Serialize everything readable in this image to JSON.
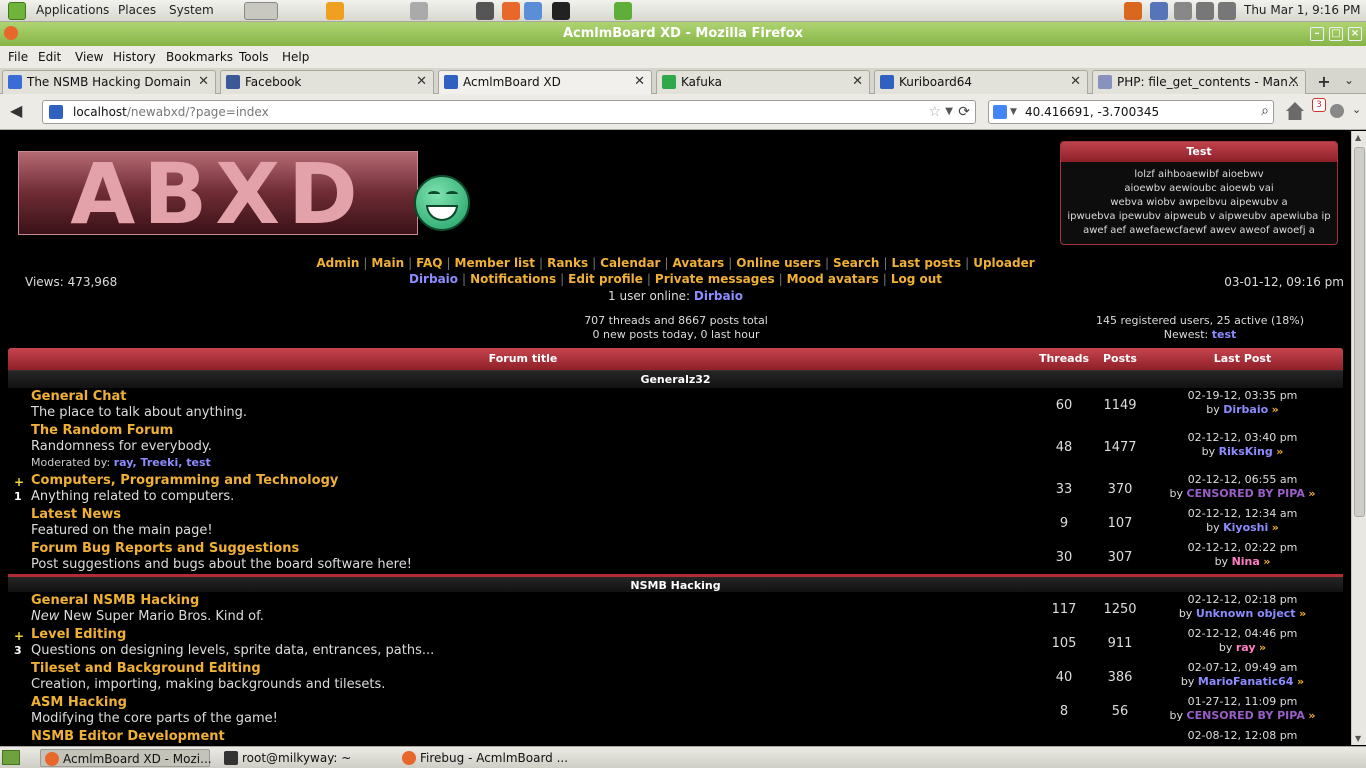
{
  "system": {
    "menus": [
      "Applications",
      "Places",
      "System"
    ],
    "clock": "Thu Mar  1,  9:16 PM"
  },
  "window": {
    "title": "AcmlmBoard XD - Mozilla Firefox"
  },
  "menubar": [
    "File",
    "Edit",
    "View",
    "History",
    "Bookmarks",
    "Tools",
    "Help"
  ],
  "tabs": [
    {
      "label": "The NSMB Hacking Domain",
      "color": "#3b6bd6"
    },
    {
      "label": "Facebook",
      "color": "#3b5998"
    },
    {
      "label": "AcmlmBoard XD",
      "color": "#3060c0"
    },
    {
      "label": "Kafuka",
      "color": "#2da84a"
    },
    {
      "label": "Kuriboard64",
      "color": "#3060c0"
    },
    {
      "label": "PHP: file_get_contents - Man...",
      "color": "#8892bf"
    }
  ],
  "nav": {
    "url_host": "localhost",
    "url_path": "/newabxd/?page=index",
    "search_value": "40.416691, -3.700345",
    "badge": "3"
  },
  "site": {
    "logo_text": "ABXD",
    "test_box": {
      "title": "Test",
      "lines": [
        "lolzf aihboaewibf aioebwv",
        "aioewbv aewioubc aioewb vai",
        "webva wiobv awpeibvu aipewubv a",
        "ipwuebva ipewubv aipweub v aipweubv apewiuba ip",
        "awef aef awefaewcfaewf awev aweof awoefj a"
      ]
    },
    "links_row1": [
      "Admin",
      "Main",
      "FAQ",
      "Member list",
      "Ranks",
      "Calendar",
      "Avatars",
      "Online users",
      "Search",
      "Last posts",
      "Uploader"
    ],
    "links_row2": [
      "Dirbaio",
      "Notifications",
      "Edit profile",
      "Private messages",
      "Mood avatars",
      "Log out"
    ],
    "online_prefix": "1 user online: ",
    "online_user": "Dirbaio",
    "views": "Views: 473,968",
    "datetime": "03-01-12, 09:16 pm",
    "stats_line1": "707 threads and 8667 posts total",
    "stats_line2": "0 new posts today, 0 last hour",
    "users_line1": "145 registered users, 25 active (18%)",
    "newest_label": "Newest: ",
    "newest_user": "test"
  },
  "forum_table": {
    "headers": {
      "title": "Forum title",
      "threads": "Threads",
      "posts": "Posts",
      "last": "Last Post"
    },
    "categories": [
      {
        "name": "Generalz32",
        "forums": [
          {
            "title": "General Chat",
            "desc": "The place to talk about anything.",
            "threads": "60",
            "posts": "1149",
            "date": "02-19-12, 03:35 pm",
            "by": "Dirbaio",
            "by_color": "#8c8cff"
          },
          {
            "title": "The Random Forum",
            "desc": "Randomness for everybody.",
            "mod_label": "Moderated by: ",
            "mods": "ray, Treeki, test",
            "threads": "48",
            "posts": "1477",
            "date": "02-12-12, 03:40 pm",
            "by": "RiksKing",
            "by_color": "#8c8cff"
          },
          {
            "title": "Computers, Programming and Technology",
            "desc": "Anything related to computers.",
            "mark": "+",
            "count": "1",
            "threads": "33",
            "posts": "370",
            "date": "02-12-12, 06:55 am",
            "by": "CENSORED BY PIPA",
            "by_color": "#9a5ec8"
          },
          {
            "title": "Latest News",
            "desc": "Featured on the main page!",
            "threads": "9",
            "posts": "107",
            "date": "02-12-12, 12:34 am",
            "by": "Kiyoshi",
            "by_color": "#8c8cff"
          },
          {
            "title": "Forum Bug Reports and Suggestions",
            "desc": "Post suggestions and bugs about the board software here!",
            "threads": "30",
            "posts": "307",
            "date": "02-12-12, 02:22 pm",
            "by": "Nina",
            "by_color": "#ff7fc0"
          }
        ]
      },
      {
        "name": "NSMB Hacking",
        "forums": [
          {
            "title": "General NSMB Hacking",
            "desc_em": "New",
            "desc": " New Super Mario Bros. Kind of.",
            "threads": "117",
            "posts": "1250",
            "date": "02-12-12, 02:18 pm",
            "by": "Unknown object",
            "by_color": "#8c8cff"
          },
          {
            "title": "Level Editing",
            "desc": "Questions on designing levels, sprite data, entrances, paths...",
            "mark": "+",
            "count": "3",
            "threads": "105",
            "posts": "911",
            "date": "02-12-12, 04:46 pm",
            "by": "ray",
            "by_color": "#ff7fc0"
          },
          {
            "title": "Tileset and Background Editing",
            "desc": "Creation, importing, making backgrounds and tilesets.",
            "threads": "40",
            "posts": "386",
            "date": "02-07-12, 09:49 am",
            "by": "MarioFanatic64",
            "by_color": "#8c8cff"
          },
          {
            "title": "ASM Hacking",
            "desc": "Modifying the core parts of the game!",
            "threads": "8",
            "posts": "56",
            "date": "01-27-12, 11:09 pm",
            "by": "CENSORED BY PIPA",
            "by_color": "#9a5ec8"
          },
          {
            "title": "NSMB Editor Development",
            "desc": "",
            "threads": "",
            "posts": "",
            "date": "02-08-12, 12:08 pm",
            "by": "",
            "by_color": "#8c8cff"
          }
        ]
      }
    ]
  },
  "taskbar": [
    {
      "label": "AcmlmBoard XD - Mozi...",
      "active": true,
      "color": "#e8672a"
    },
    {
      "label": "root@milkyway: ~",
      "active": false,
      "color": "#333"
    },
    {
      "label": "Firebug - AcmlmBoard ...",
      "active": false,
      "color": "#e8672a"
    }
  ]
}
